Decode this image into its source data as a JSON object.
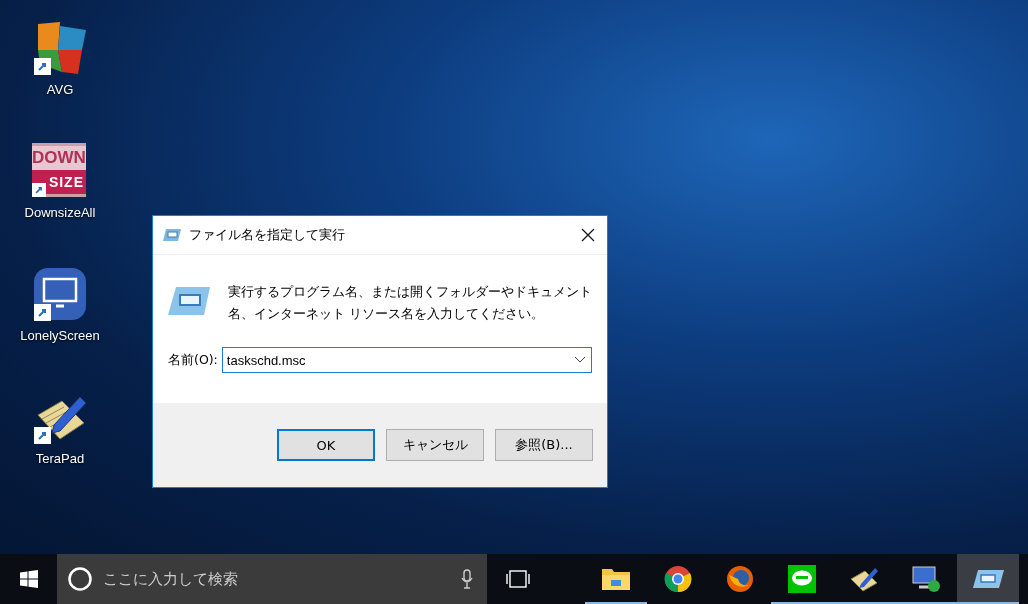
{
  "desktop_icons": [
    {
      "kind": "avg",
      "label": "AVG"
    },
    {
      "kind": "downsize",
      "label": "DownsizeAll",
      "logo_text": [
        "DOWN",
        "SIZE"
      ]
    },
    {
      "kind": "monitor",
      "label": "LonelyScreen"
    },
    {
      "kind": "notepad",
      "label": "TeraPad"
    }
  ],
  "dialog": {
    "title": "ファイル名を指定して実行",
    "message": "実行するプログラム名、または開くフォルダーやドキュメント名、インターネット リソース名を入力してください。",
    "field_label": "名前(O):",
    "field_value": "taskschd.msc",
    "buttons": [
      {
        "label": "OK",
        "selected": true
      },
      {
        "label": "キャンセル",
        "selected": false
      },
      {
        "label": "参照(B)...",
        "selected": false
      }
    ]
  },
  "taskbar": {
    "search": {
      "placeholder": "ここに入力して検索"
    },
    "apps": [
      {
        "kind": "folder",
        "running": true,
        "selected": false
      },
      {
        "kind": "chrome",
        "running": false,
        "selected": false
      },
      {
        "kind": "firefox",
        "running": false,
        "selected": false
      },
      {
        "kind": "chat",
        "running": true,
        "selected": false
      },
      {
        "kind": "notepad",
        "running": true,
        "selected": false
      },
      {
        "kind": "remote",
        "running": true,
        "selected": false
      },
      {
        "kind": "run",
        "running": true,
        "selected": true
      }
    ]
  }
}
